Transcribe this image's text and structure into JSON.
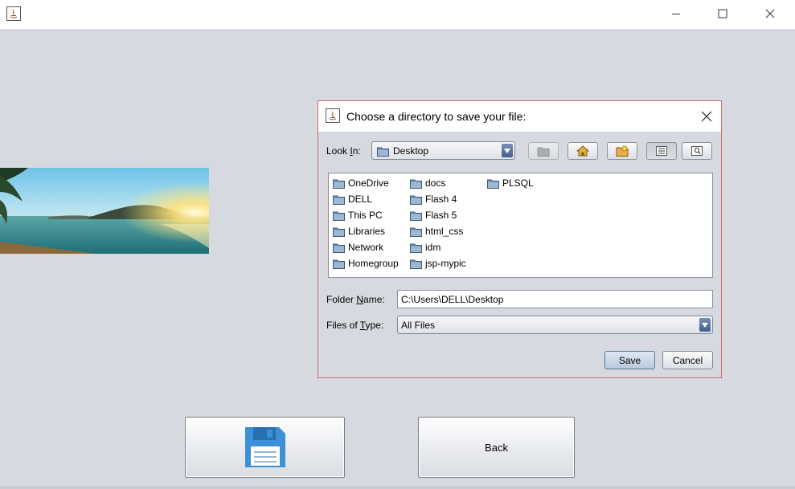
{
  "window": {
    "title": ""
  },
  "main": {
    "back_label": "Back"
  },
  "dialog": {
    "title": "Choose a directory to save your file:",
    "look_in_label": "Look ",
    "look_in_mnemonic": "I",
    "look_in_suffix": "n:",
    "look_in_value": "Desktop",
    "folder_name_label": "Folder ",
    "folder_name_mnemonic": "N",
    "folder_name_suffix": "ame:",
    "folder_name_value": "C:\\Users\\DELL\\Desktop",
    "files_of_type_label": "Files of ",
    "files_of_type_mnemonic": "T",
    "files_of_type_suffix": "ype:",
    "files_of_type_value": "All Files",
    "save_label": "Save",
    "cancel_label": "Cancel",
    "items": [
      "OneDrive",
      "DELL",
      "This PC",
      "Libraries",
      "Network",
      "Homegroup",
      "docs",
      "Flash 4",
      "Flash 5",
      "html_css",
      "idm",
      "jsp-mypic",
      "PLSQL"
    ]
  },
  "colors": {
    "dialog_border": "#d0676f",
    "background": "#d6d9df",
    "folder_icon": "#6f8fb8",
    "floppy_icon": "#3d8fd6"
  }
}
